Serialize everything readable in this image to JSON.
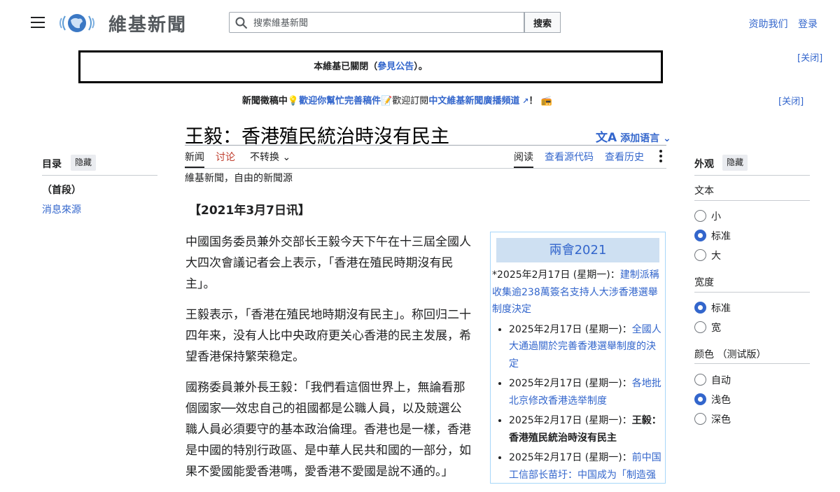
{
  "header": {
    "logo_text": "維基新聞",
    "search_placeholder": "搜索維基新聞",
    "search_button": "搜索",
    "donate": "资助我们",
    "login": "登录"
  },
  "notice": {
    "prefix": "本維基已關閉（",
    "link": "參見公告",
    "suffix": "）。",
    "close": "[关闭]"
  },
  "sitenotice": {
    "lead": "新聞徵稿中",
    "link1": "歡迎你幫忙完善稿件",
    "text2": "歡迎訂閱",
    "link2": "中文維基新聞廣播頻道",
    "tail": "！",
    "close": "[关闭]"
  },
  "page": {
    "title": "王毅：香港殖民統治時沒有民主",
    "add_languages": "添加语言",
    "tabs": {
      "news": "新闻",
      "discuss": "讨论",
      "variant": "不转换",
      "read": "阅读",
      "view_source": "查看源代码",
      "history": "查看历史"
    },
    "tagline": "維基新聞，自由的新聞源",
    "dateline": "【2021年3月7日讯】"
  },
  "article": {
    "paragraphs": [
      "中國国务委员兼外交部长王毅今天下午在十三屆全國人大四次會議记者会上表示，「香港在殖民時期沒有民主」。",
      "王毅表示，「香港在殖民地時期沒有民主」。称回归二十四年来，没有人比中央政府更关心香港的民主发展，希望香港保持繁荣稳定。",
      "國務委員兼外長王毅：「我們看這個世界上，無論看那個國家──效忠自己的祖國都是公職人員，以及競選公職人員必須要守的基本政治倫理。香港也是一樣，香港是中國的特別行政區、是中華人民共和國的一部分，如果不愛國能愛香港嗎，愛香港不愛國是說不通的。」"
    ]
  },
  "infobox": {
    "title": "兩會2021",
    "first": {
      "date": "*2025年2月17日 (星期一)：",
      "link": "建制派稱收集逾238萬簽名支持人大涉香港選舉制度決定"
    },
    "items": [
      {
        "date": "2025年2月17日 (星期一)：",
        "link": "全國人大通過關於完善香港選舉制度的決定"
      },
      {
        "date": "2025年2月17日 (星期一)：",
        "link": "各地批北京修改香港选举制度"
      },
      {
        "date": "2025年2月17日 (星期一)：",
        "current": "王毅：香港殖民統治時沒有民主"
      },
      {
        "date": "2025年2月17日 (星期一)：",
        "link": "前中国工信部长苗圩：中国成为「制造强国」需三十年"
      }
    ]
  },
  "toc": {
    "title": "目录",
    "hide": "隐藏",
    "top": "（首段）",
    "items": [
      "消息來源"
    ]
  },
  "appearance": {
    "title": "外观",
    "hide": "隐藏",
    "text_label": "文本",
    "text_options": [
      "小",
      "标准",
      "大"
    ],
    "text_selected": "标准",
    "width_label": "宽度",
    "width_options": [
      "标准",
      "宽"
    ],
    "width_selected": "标准",
    "color_label": "颜色 （测试版）",
    "color_options": [
      "自动",
      "浅色",
      "深色"
    ],
    "color_selected": "浅色"
  },
  "colors": {
    "link": "#3366cc",
    "text": "#202122",
    "infobox_head": "#cee0f2"
  }
}
